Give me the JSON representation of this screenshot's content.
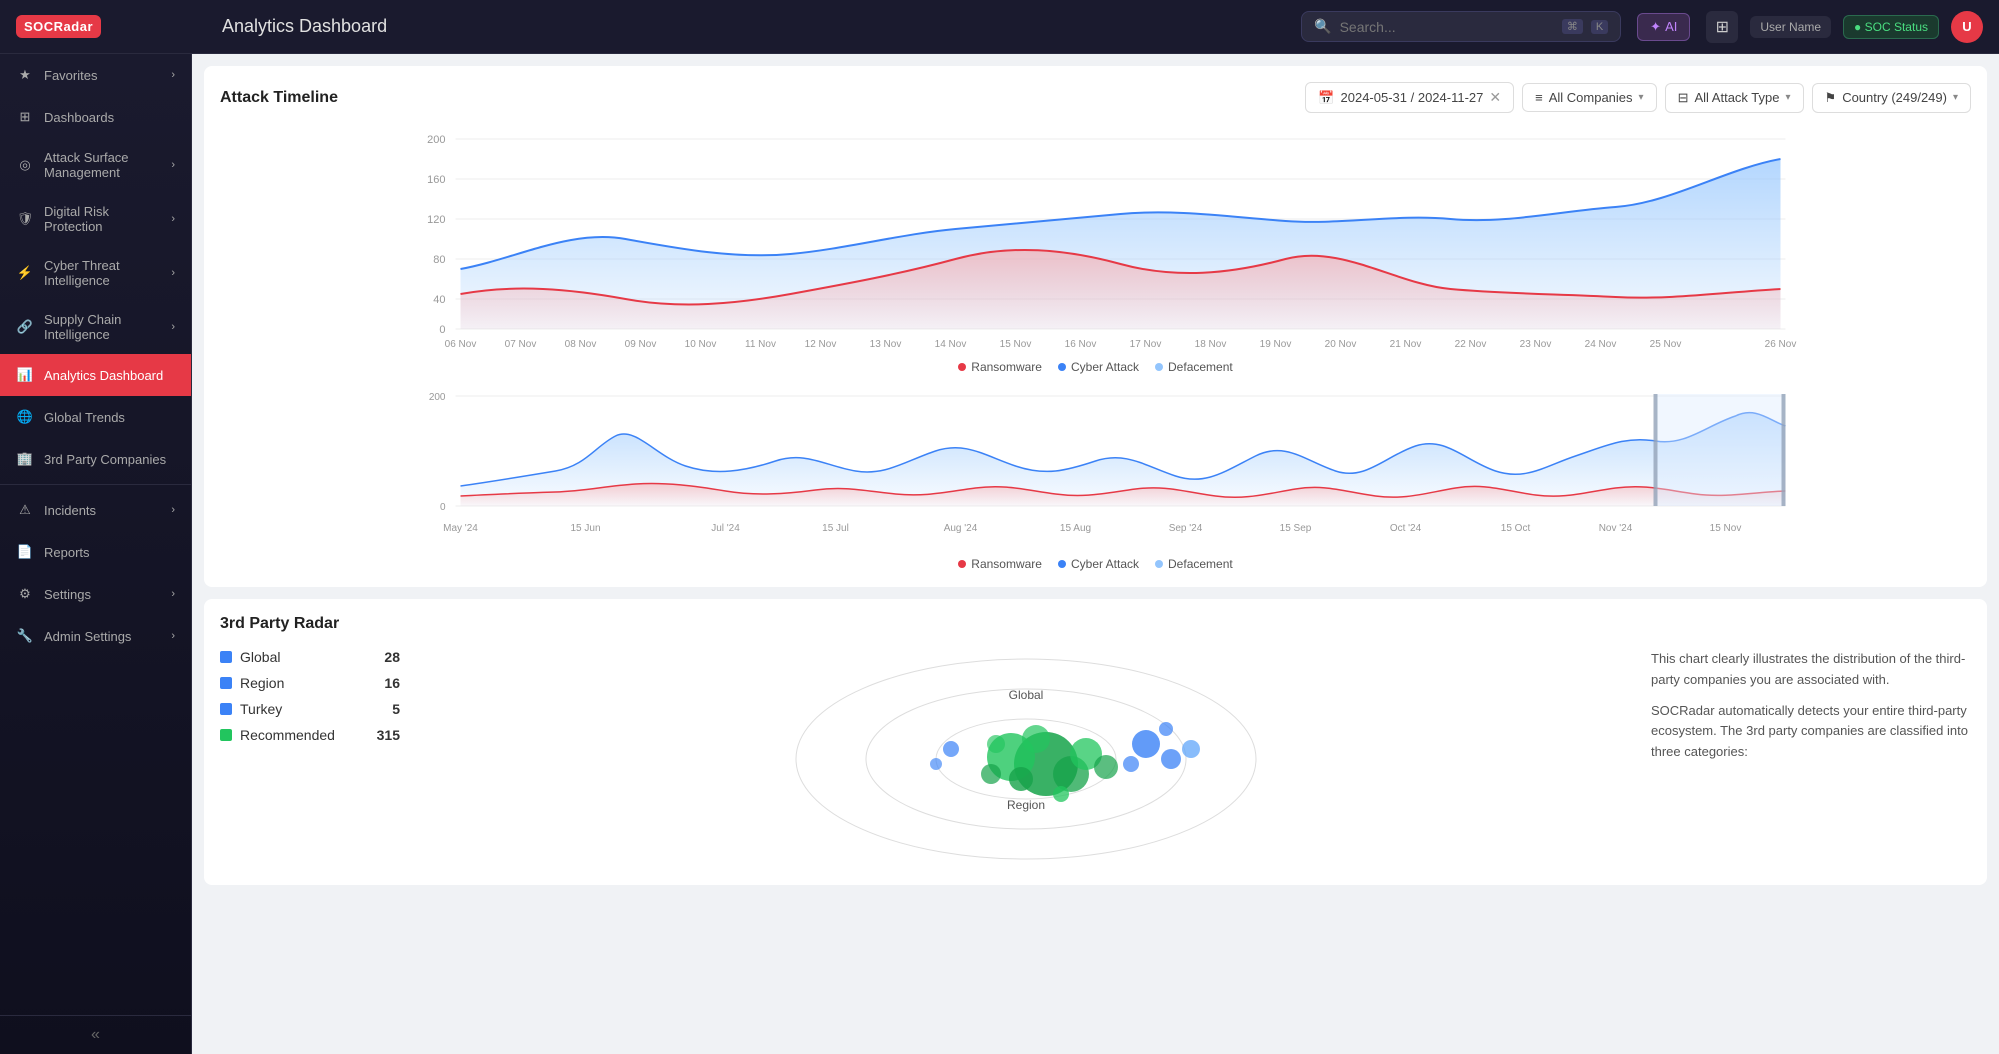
{
  "topbar": {
    "logo": "SOCRadar",
    "title": "Analytics Dashboard",
    "search_placeholder": "Search...",
    "kbd1": "⌘",
    "kbd2": "K",
    "ai_label": "AI",
    "user_name": "User Name",
    "status_text": "● SOC Status",
    "avatar_initials": "U"
  },
  "sidebar": {
    "items": [
      {
        "id": "favorites",
        "label": "Favorites",
        "icon": "★",
        "has_chevron": true
      },
      {
        "id": "dashboards",
        "label": "Dashboards",
        "icon": "⊞",
        "has_chevron": false
      },
      {
        "id": "attack-surface",
        "label": "Attack Surface Management",
        "icon": "◎",
        "has_chevron": true
      },
      {
        "id": "digital-risk",
        "label": "Digital Risk Protection",
        "icon": "🛡",
        "has_chevron": true
      },
      {
        "id": "cyber-threat",
        "label": "Cyber Threat Intelligence",
        "icon": "⚡",
        "has_chevron": true
      },
      {
        "id": "supply-chain",
        "label": "Supply Chain Intelligence",
        "icon": "🔗",
        "has_chevron": true
      },
      {
        "id": "analytics",
        "label": "Analytics Dashboard",
        "icon": "📊",
        "has_chevron": false,
        "active": true
      },
      {
        "id": "global-trends",
        "label": "Global Trends",
        "icon": "🌐",
        "has_chevron": false
      },
      {
        "id": "3rd-party",
        "label": "3rd Party Companies",
        "icon": "🏢",
        "has_chevron": false
      },
      {
        "id": "incidents",
        "label": "Incidents",
        "icon": "⚠",
        "has_chevron": true
      },
      {
        "id": "reports",
        "label": "Reports",
        "icon": "📄",
        "has_chevron": false
      },
      {
        "id": "settings",
        "label": "Settings",
        "icon": "⚙",
        "has_chevron": true
      },
      {
        "id": "admin",
        "label": "Admin Settings",
        "icon": "🔧",
        "has_chevron": true
      }
    ],
    "collapse_label": "«"
  },
  "attack_timeline": {
    "title": "Attack Timeline",
    "date_range": "2024-05-31 / 2024-11-27",
    "all_companies": "All Companies",
    "all_attack_type": "All Attack Type",
    "country": "Country (249/249)",
    "legend": {
      "ransomware": "Ransomware",
      "cyber_attack": "Cyber Attack",
      "defacement": "Defacement"
    },
    "y_labels_detail": [
      "200",
      "160",
      "120",
      "80",
      "40",
      "0"
    ],
    "x_labels_detail": [
      "06 Nov",
      "07 Nov",
      "08 Nov",
      "09 Nov",
      "10 Nov",
      "11 Nov",
      "12 Nov",
      "13 Nov",
      "14 Nov",
      "15 Nov",
      "16 Nov",
      "17 Nov",
      "18 Nov",
      "19 Nov",
      "20 Nov",
      "21 Nov",
      "22 Nov",
      "23 Nov",
      "24 Nov",
      "25 Nov",
      "26 Nov"
    ],
    "y_labels_overview": [
      "200",
      "0"
    ],
    "x_labels_overview": [
      "May '24",
      "15 Jun",
      "Jul '24",
      "15 Jul",
      "Aug '24",
      "15 Aug",
      "Sep '24",
      "15 Sep",
      "Oct '24",
      "15 Oct",
      "Nov '24",
      "15 Nov"
    ]
  },
  "radar": {
    "title": "3rd Party Radar",
    "legend": [
      {
        "label": "Global",
        "count": "28",
        "color": "#3b82f6"
      },
      {
        "label": "Region",
        "count": "16",
        "color": "#3b82f6"
      },
      {
        "label": "Turkey",
        "count": "5",
        "color": "#3b82f6"
      },
      {
        "label": "Recommended",
        "count": "315",
        "color": "#22c55e"
      }
    ],
    "chart_label_global": "Global",
    "chart_label_region": "Region",
    "description_1": "This chart clearly illustrates the distribution of the third-party companies you are associated with.",
    "description_2": "SOCRadar automatically detects your entire third-party ecosystem. The 3rd party companies are classified into three categories:"
  },
  "colors": {
    "accent": "#e63946",
    "sidebar_bg": "#1a1a2e",
    "active_item": "#e63946",
    "ransomware": "#e63946",
    "cyber_attack": "#3b82f6",
    "defacement": "#93c5fd",
    "green": "#22c55e",
    "blue": "#3b82f6"
  }
}
